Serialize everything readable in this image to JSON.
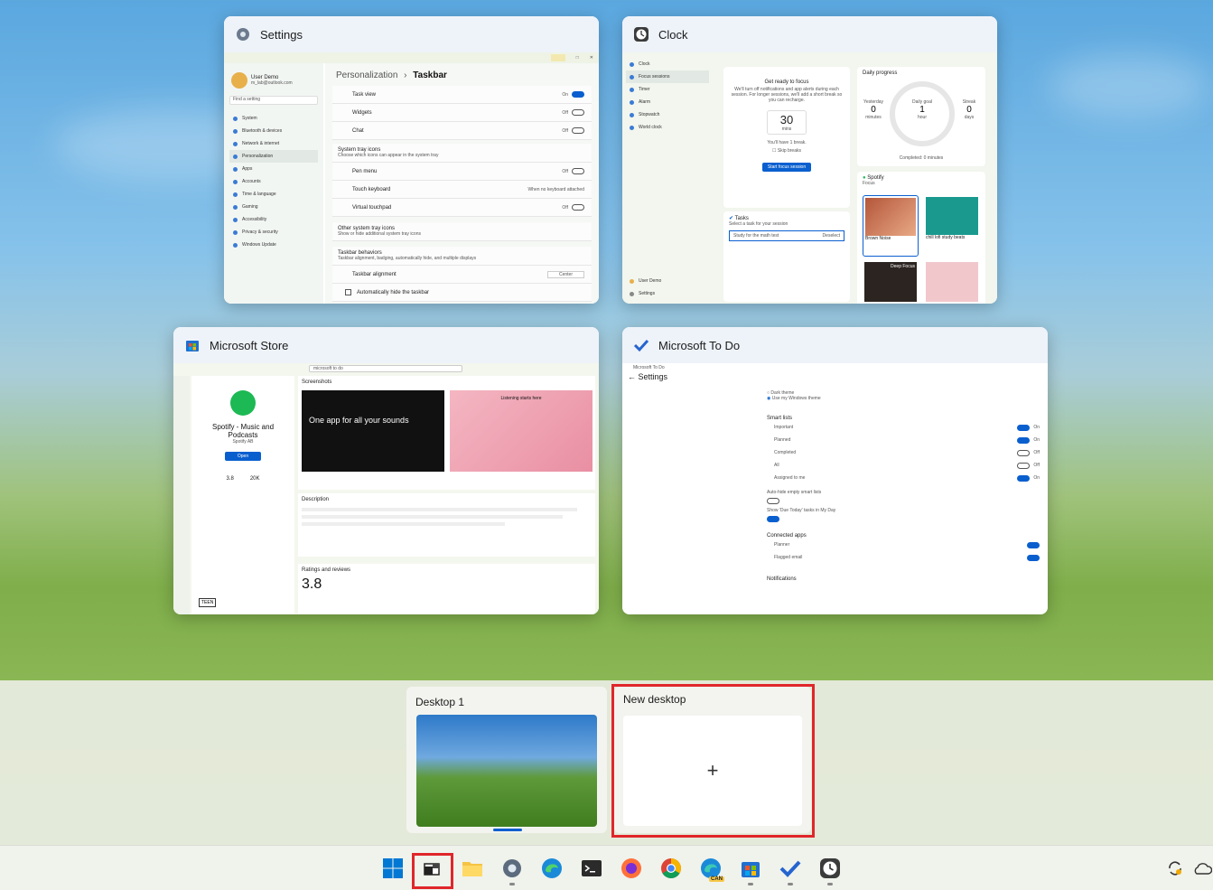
{
  "windows": [
    {
      "title": "Settings",
      "icon": "gear-icon"
    },
    {
      "title": "Clock",
      "icon": "clock-icon"
    },
    {
      "title": "Microsoft Store",
      "icon": "store-icon"
    },
    {
      "title": "Microsoft To Do",
      "icon": "check-icon"
    }
  ],
  "settings": {
    "breadcrumb_parent": "Personalization",
    "breadcrumb_sep": "›",
    "breadcrumb_current": "Taskbar",
    "user_name": "User Demo",
    "user_email": "m_lab@outlook.com",
    "search_placeholder": "Find a setting",
    "nav": [
      "System",
      "Bluetooth & devices",
      "Network & internet",
      "Personalization",
      "Apps",
      "Accounts",
      "Time & language",
      "Gaming",
      "Accessibility",
      "Privacy & security",
      "Windows Update"
    ],
    "rows": [
      {
        "label": "Task view",
        "value": "On"
      },
      {
        "label": "Widgets",
        "value": "Off"
      },
      {
        "label": "Chat",
        "value": "Off"
      }
    ],
    "tray_title": "System tray icons",
    "tray_sub": "Choose which icons can appear in the system tray",
    "tray_rows": [
      {
        "label": "Pen menu",
        "value": "Off"
      },
      {
        "label": "Touch keyboard",
        "value": "When no keyboard attached"
      },
      {
        "label": "Virtual touchpad",
        "value": "Off"
      }
    ],
    "other_title": "Other system tray icons",
    "other_sub": "Show or hide additional system tray icons",
    "behav_title": "Taskbar behaviors",
    "behav_sub": "Taskbar alignment, badging, automatically hide, and multiple displays",
    "align_label": "Taskbar alignment",
    "align_value": "Center",
    "autohide_label": "Automatically hide the taskbar"
  },
  "clock": {
    "nav": [
      "Clock",
      "Focus sessions",
      "Timer",
      "Alarm",
      "Stopwatch",
      "World clock"
    ],
    "user": "User Demo",
    "settings": "Settings",
    "focus_title": "Get ready to focus",
    "focus_desc": "We'll turn off notifications and app alerts during each session. For longer sessions, we'll add a short break so you can recharge.",
    "minutes": "30",
    "mins_unit": "mins",
    "break_text": "You'll have 1 break.",
    "skip": "Skip breaks",
    "start": "Start focus session",
    "daily": "Daily progress",
    "yesterday_label": "Yesterday",
    "yesterday_val": "0",
    "yesterday_unit": "minutes",
    "goal_label": "Daily goal",
    "goal_val": "1",
    "goal_unit": "hour",
    "streak_label": "Streak",
    "streak_val": "0",
    "streak_unit": "days",
    "completed": "Completed: 0 minutes",
    "tasks": "Tasks",
    "task_hint": "Select a task for your session",
    "task_item": "Study for the math test",
    "deselect": "Deselect",
    "spotify": "Spotify",
    "focus_label": "Focus",
    "tile1": "Brown Noise",
    "tile2": "chill lofi study beats",
    "tile3": "Deep Focus"
  },
  "store": {
    "search": "microsoft to do",
    "app_name": "Spotify - Music and Podcasts",
    "publisher": "Spotify AB",
    "open": "Open",
    "rating": "3.8",
    "ratings_count": "20K",
    "screenshots": "Screenshots",
    "promo": "One app for all your sounds",
    "promo2": "Listening starts here",
    "description": "Description",
    "ratings": "Ratings and reviews",
    "big_rating": "3.8",
    "teen": "TEEN"
  },
  "todo": {
    "app": "Microsoft To Do",
    "settings": "Settings",
    "theme1": "Dark theme",
    "theme2": "Use my Windows theme",
    "smart": "Smart lists",
    "lists": [
      {
        "label": "Important",
        "value": "On"
      },
      {
        "label": "Planned",
        "value": "On"
      },
      {
        "label": "Completed",
        "value": "Off"
      },
      {
        "label": "All",
        "value": "Off"
      },
      {
        "label": "Assigned to me",
        "value": "On"
      }
    ],
    "auto_hide": "Auto-hide empty smart lists",
    "show_due": "Show 'Due Today' tasks in My Day",
    "connected": "Connected apps",
    "planner": "Planner",
    "flagged": "Flagged email",
    "notifications": "Notifications"
  },
  "desktops": {
    "desktop1": "Desktop 1",
    "new_desktop": "New desktop",
    "plus": "+"
  },
  "taskbar": {
    "icons": [
      "windows-start-icon",
      "task-view-icon",
      "file-explorer-icon",
      "settings-icon",
      "edge-icon",
      "terminal-icon",
      "firefox-icon",
      "chrome-icon",
      "edge-canary-icon",
      "store-icon",
      "todo-icon",
      "clock-icon"
    ],
    "can_badge": "CAN"
  },
  "colors": {
    "accent": "#0a5fcf",
    "highlight": "#e0262b"
  }
}
